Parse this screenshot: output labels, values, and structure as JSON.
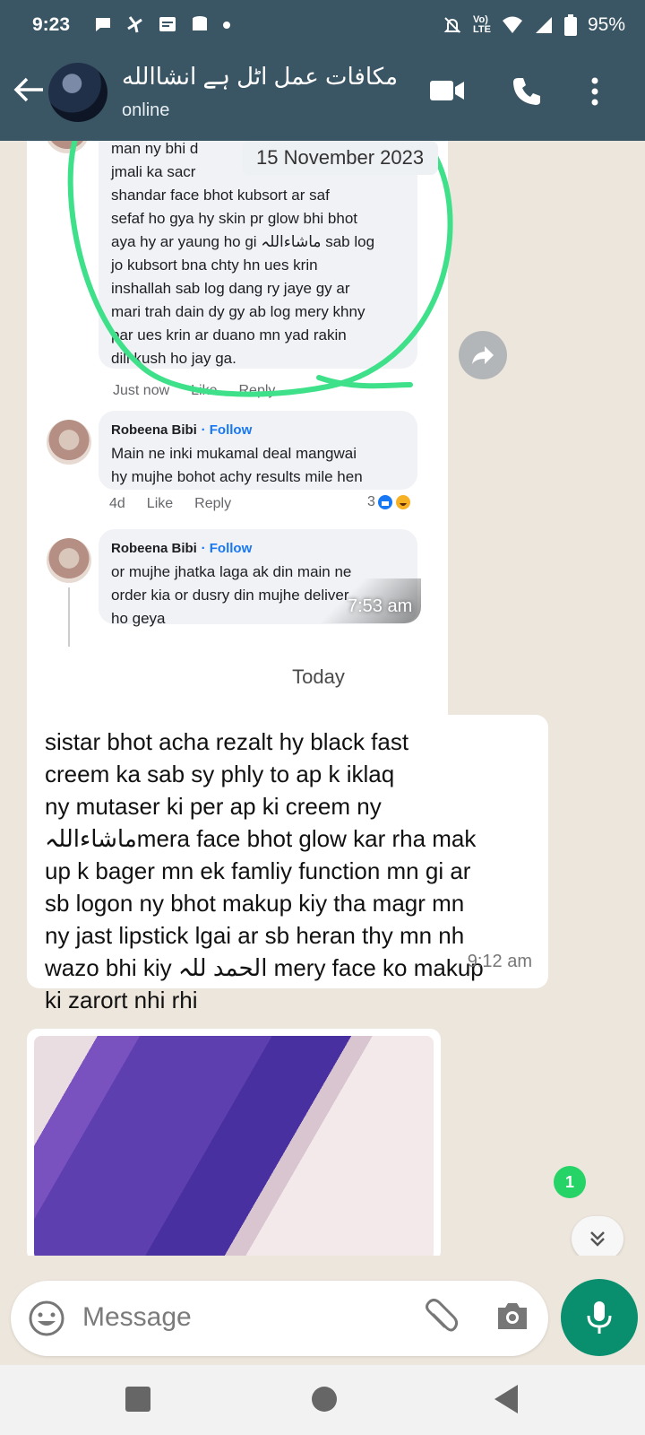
{
  "status_bar": {
    "time": "9:23",
    "network_label": "LTE",
    "network_prefix": "Vo)",
    "battery": "95%"
  },
  "header": {
    "title": "مکافات عمل اٹل ہے انشاالله",
    "status": "online"
  },
  "image_message": {
    "date_chip": "15 November 2023",
    "comments": [
      {
        "text_line1": "man ny bhi d",
        "text_line2": "jmali ka sacr",
        "text_line3": "shandar face bhot kubsort ar saf",
        "text_line4": "sefaf ho gya hy skin pr glow bhi bhot",
        "text_line5": "aya hy ar yaung ho gi ماشاءاللہ sab log",
        "text_line6": "jo kubsort bna chty hn ues krin",
        "text_line7": "inshallah sab log dang ry jaye gy ar",
        "text_line8": "mari trah dain dy gy ab log mery khny",
        "text_line9": "par ues krin ar duano mn yad rakin",
        "text_line10": "dill kush ho jay ga.",
        "meta_time": "Just now",
        "meta_like": "Like",
        "meta_reply": "Reply"
      },
      {
        "name": "Robeena Bibi",
        "follow": "· Follow",
        "text_line1": "Main ne inki mukamal deal mangwai",
        "text_line2": "hy mujhe bohot achy results mile hen",
        "meta_time": "4d",
        "meta_like": "Like",
        "meta_reply": "Reply",
        "reaction_count": "3"
      },
      {
        "name": "Robeena Bibi",
        "follow": "· Follow",
        "text_line1": "or mujhe jhatka laga ak din main ne",
        "text_line2": "order kia or dusry din mujhe deliver",
        "text_line3": "ho geya"
      }
    ],
    "time": "7:53 am"
  },
  "day_separator": "Today",
  "text_message": {
    "lines": [
      "sistar bhot acha rezalt hy black fast",
      "creem ka sab sy phly to ap k iklaq",
      "ny mutaser ki per ap ki creem ny",
      "ماشاءاللہmera face bhot glow kar rha mak",
      "up k bager mn ek famliy function mn gi ar",
      "sb logon ny bhot makup kiy tha magr mn",
      "ny jast lipstick lgai ar sb heran thy mn nh",
      "wazo bhi kiy الحمد للہ mery face ko makup",
      "ki zarort nhi rhi"
    ],
    "time": "9:12 am"
  },
  "unread_count": "1",
  "input": {
    "placeholder": "Message"
  },
  "icons": {
    "back": "back-arrow-icon",
    "video": "video-call-icon",
    "call": "phone-icon",
    "menu": "more-vert-icon",
    "emoji": "emoji-icon",
    "attach": "paperclip-icon",
    "camera": "camera-icon",
    "mic": "mic-icon",
    "forward": "forward-icon",
    "scroll_down": "double-chevron-down-icon"
  },
  "colors": {
    "header_bg": "#3a5564",
    "chat_bg": "#ede6dc",
    "mic_button": "#0a8f6e",
    "unread_badge": "#25d366",
    "highlight_stroke": "#3fe08a"
  }
}
